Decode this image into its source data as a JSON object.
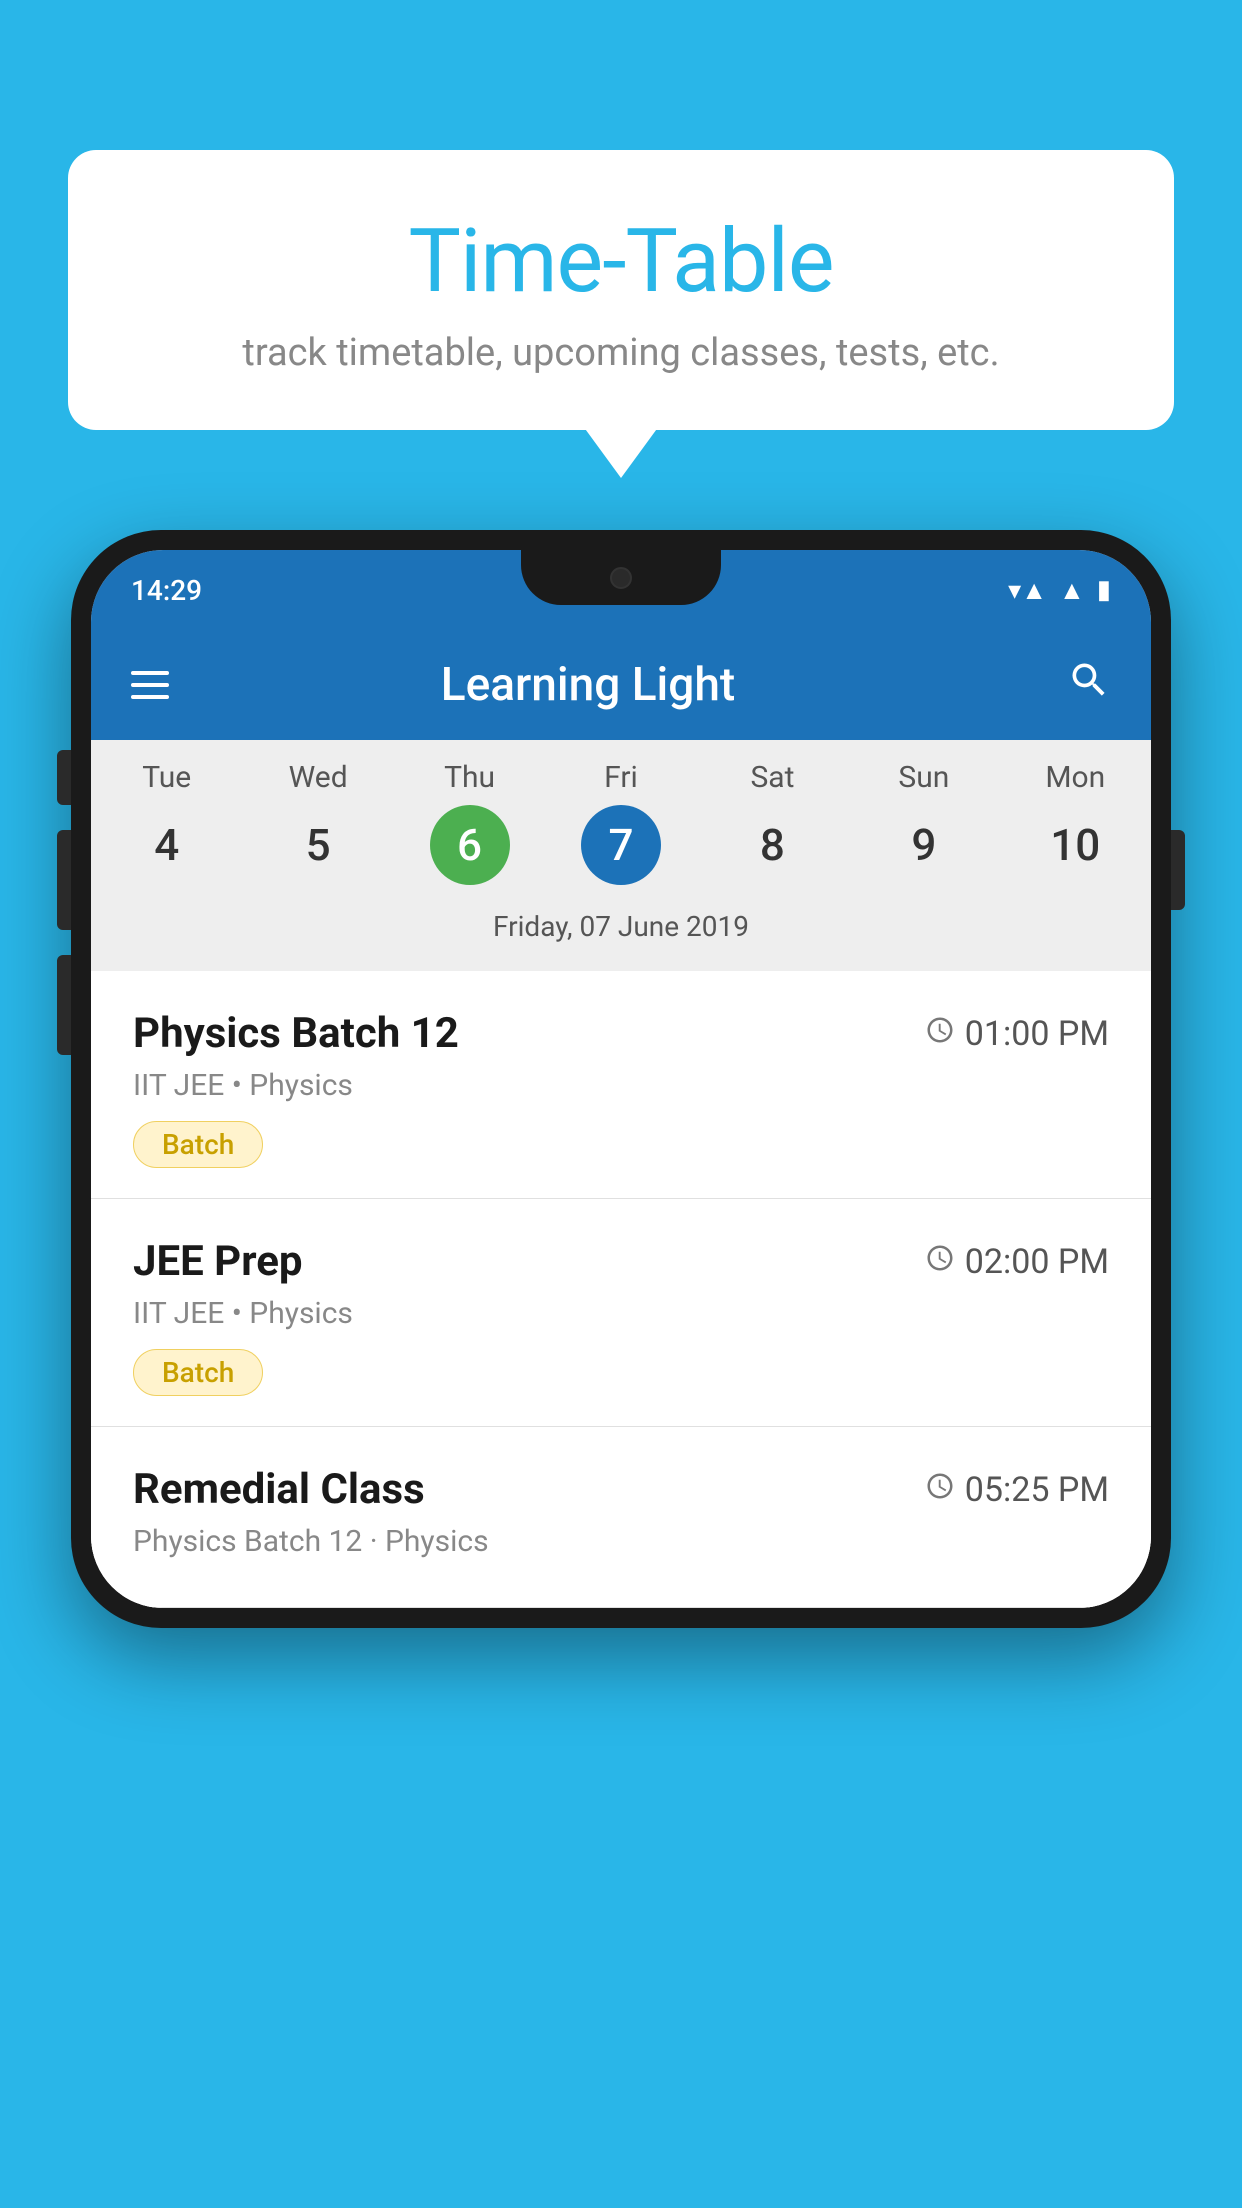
{
  "background_color": "#29b6e8",
  "bubble": {
    "title": "Time-Table",
    "subtitle": "track timetable, upcoming classes, tests, etc."
  },
  "status_bar": {
    "time": "14:29",
    "icons": [
      "wifi",
      "signal",
      "battery"
    ]
  },
  "app_bar": {
    "title": "Learning Light",
    "hamburger_label": "menu",
    "search_label": "search"
  },
  "calendar": {
    "days": [
      {
        "label": "Tue",
        "num": "4"
      },
      {
        "label": "Wed",
        "num": "5"
      },
      {
        "label": "Thu",
        "num": "6",
        "state": "today"
      },
      {
        "label": "Fri",
        "num": "7",
        "state": "selected"
      },
      {
        "label": "Sat",
        "num": "8"
      },
      {
        "label": "Sun",
        "num": "9"
      },
      {
        "label": "Mon",
        "num": "10"
      }
    ],
    "selected_date": "Friday, 07 June 2019"
  },
  "schedule": [
    {
      "name": "Physics Batch 12",
      "time": "01:00 PM",
      "details": "IIT JEE • Physics",
      "badge": "Batch"
    },
    {
      "name": "JEE Prep",
      "time": "02:00 PM",
      "details": "IIT JEE • Physics",
      "badge": "Batch"
    },
    {
      "name": "Remedial Class",
      "time": "05:25 PM",
      "details": "Physics Batch 12 · Physics",
      "badge": null
    }
  ]
}
